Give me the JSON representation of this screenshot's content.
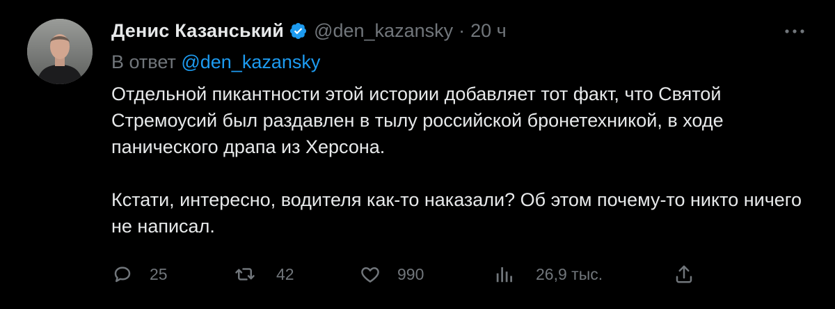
{
  "author": {
    "display_name": "Денис Казанський",
    "handle": "@den_kazansky",
    "separator": "·",
    "time": "20 ч",
    "avatar_icon": "user-avatar-photo",
    "verified_icon": "verified-badge-icon"
  },
  "reply": {
    "prefix": "В ответ",
    "mention": "@den_kazansky"
  },
  "content": {
    "paragraph1": "Отдельной пикантности этой истории добавляет тот факт, что Святой Стремоусий был раздавлен в тылу российской бронетехникой, в ходе панического драпа из Херсона.",
    "paragraph2": "Кстати, интересно, водителя как-то наказали? Об этом почему-то никто ничего не написал."
  },
  "actions": {
    "replies": "25",
    "retweets": "42",
    "likes": "990",
    "views": "26,9 тыс."
  },
  "colors": {
    "background": "#000000",
    "text": "#e7e9ea",
    "muted": "#71767b",
    "accent": "#1d9bf0"
  }
}
